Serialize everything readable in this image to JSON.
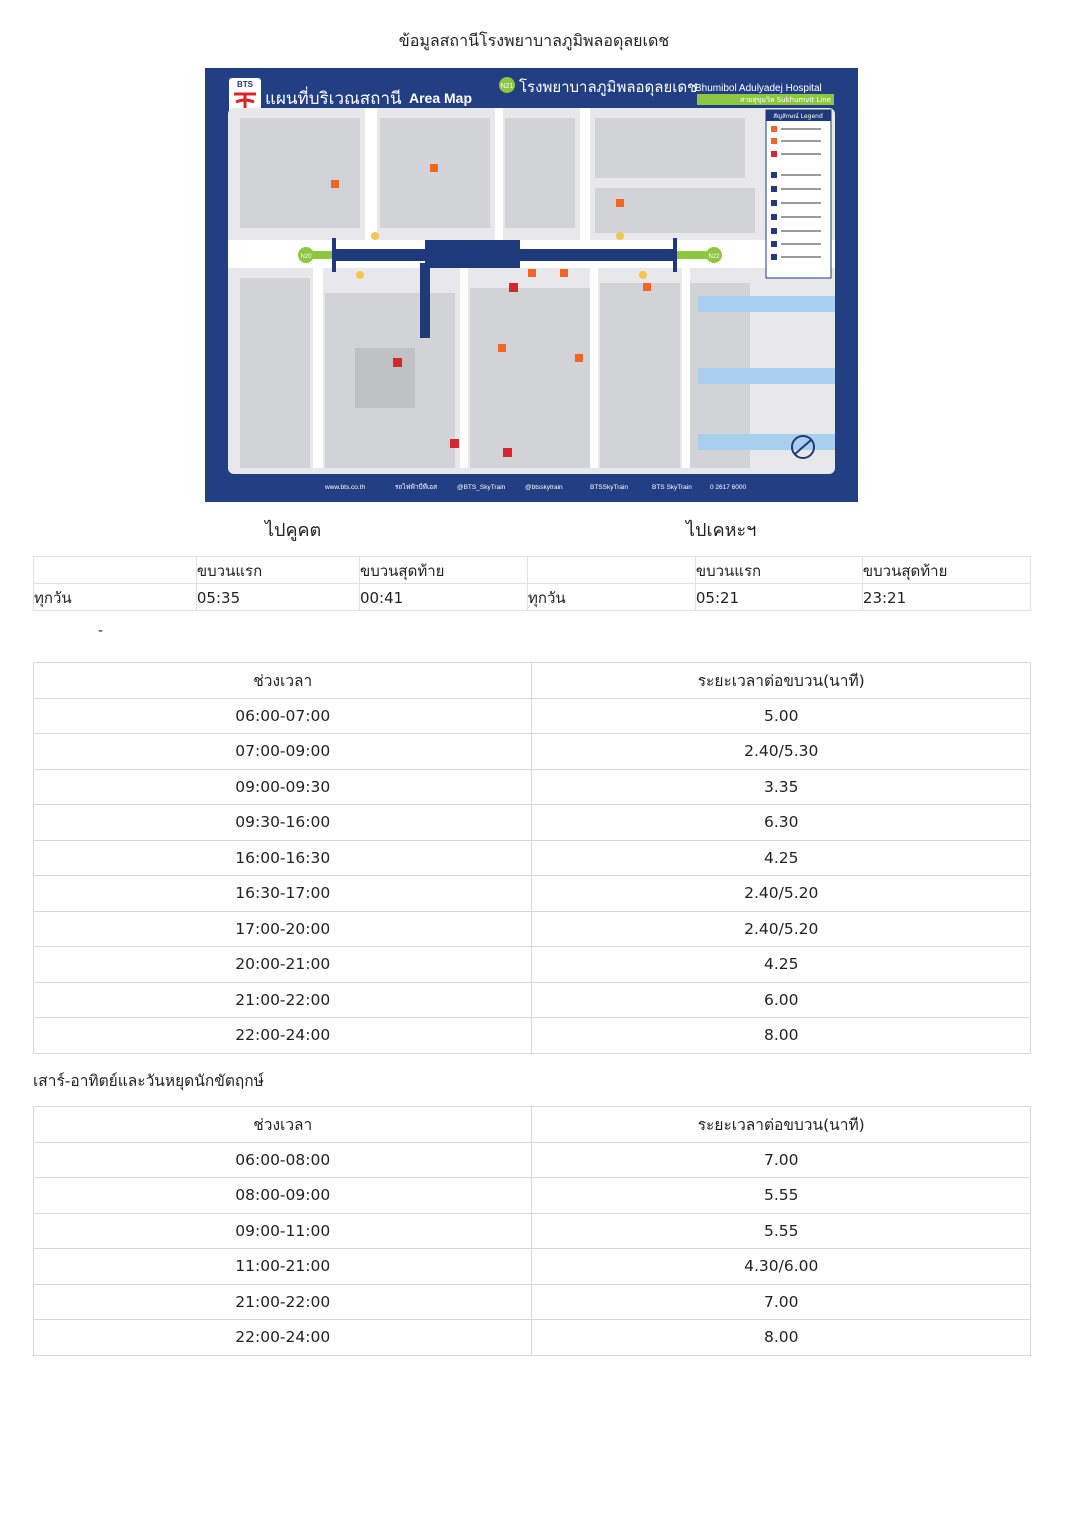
{
  "title": "ข้อมูลสถานีโรงพยาบาลภูมิพลอดุลยเดช",
  "map": {
    "logo": "BTS",
    "heading_th": "แผนที่บริเวณสถานี",
    "heading_en": "Area Map",
    "station_code": "N21",
    "station_th": "โรงพยาบาลภูมิพลอดุลยเดช",
    "station_en": "Bhumibol Adulyadej Hospital",
    "line": "สายสุขุมวิท Sukhumvit Line",
    "legend_title": "สัญลักษณ์ Legend",
    "prev_code": "N20",
    "next_code": "N22",
    "footer": [
      "www.bts.co.th",
      "รถไฟฟ้าบีทีเอส",
      "@BTS_SkyTrain",
      "@btsskytrain",
      "BTSSkyTrain",
      "BTS SkyTrain",
      "0 2617 6000"
    ],
    "colors": {
      "frame": "#233f84",
      "line_green": "#8dc63f",
      "track": "#1f3a7a"
    }
  },
  "directions": {
    "left": "ไปคูคต",
    "right": "ไปเคหะฯ"
  },
  "first_last": {
    "header": [
      "",
      "ขบวนแรก",
      "ขบวนสุดท้าย",
      "",
      "ขบวนแรก",
      "ขบวนสุดท้าย"
    ],
    "row": [
      "ทุกวัน",
      "05:35",
      "00:41",
      "ทุกวัน",
      "05:21",
      "23:21"
    ]
  },
  "dash": "-",
  "weekday": {
    "header": [
      "ช่วงเวลา",
      "ระยะเวลาต่อขบวน(นาที)"
    ],
    "rows": [
      [
        "06:00-07:00",
        "5.00"
      ],
      [
        "07:00-09:00",
        "2.40/5.30"
      ],
      [
        "09:00-09:30",
        "3.35"
      ],
      [
        "09:30-16:00",
        "6.30"
      ],
      [
        "16:00-16:30",
        "4.25"
      ],
      [
        "16:30-17:00",
        "2.40/5.20"
      ],
      [
        "17:00-20:00",
        "2.40/5.20"
      ],
      [
        "20:00-21:00",
        "4.25"
      ],
      [
        "21:00-22:00",
        "6.00"
      ],
      [
        "22:00-24:00",
        "8.00"
      ]
    ]
  },
  "weekend_label": "เสาร์-อาทิตย์และวันหยุดนักขัตฤกษ์",
  "weekend": {
    "header": [
      "ช่วงเวลา",
      "ระยะเวลาต่อขบวน(นาที)"
    ],
    "rows": [
      [
        "06:00-08:00",
        "7.00"
      ],
      [
        "08:00-09:00",
        "5.55"
      ],
      [
        "09:00-11:00",
        "5.55"
      ],
      [
        "11:00-21:00",
        "4.30/6.00"
      ],
      [
        "21:00-22:00",
        "7.00"
      ],
      [
        "22:00-24:00",
        "8.00"
      ]
    ]
  }
}
